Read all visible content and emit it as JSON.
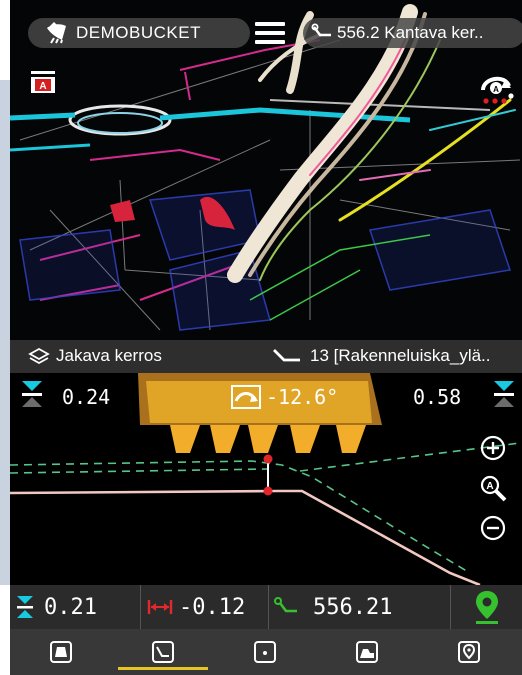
{
  "header": {
    "bucket_label": "DEMOBUCKET",
    "line_label": "556.2 Kantava ker..",
    "bucket_icon": "bucket-icon",
    "menu_icon": "hamburger-menu-icon",
    "line_icon": "alignment-line-icon"
  },
  "map": {
    "left_icon": "model-view-icon",
    "right_icon": "auto-rotate-icon"
  },
  "layer_bar": {
    "layer_label": "Jakava kerros",
    "surface_label": "13 [Rakenneluiska_ylä.."
  },
  "profile": {
    "left_depth": "0.24",
    "right_depth": "0.58",
    "tilt_value": "-12.6°",
    "zoom_in_icon": "zoom-in-icon",
    "zoom_auto_icon": "zoom-auto-icon",
    "zoom_out_icon": "zoom-out-icon"
  },
  "readouts": {
    "depth": "0.21",
    "distance": "-0.12",
    "station": "556.21"
  },
  "tabs": [
    {
      "name": "tab-excavator",
      "icon": "excavator-view-icon",
      "active": false
    },
    {
      "name": "tab-profile",
      "icon": "profile-view-icon",
      "active": true
    },
    {
      "name": "tab-point",
      "icon": "point-view-icon",
      "active": false
    },
    {
      "name": "tab-machine",
      "icon": "machine-view-icon",
      "active": false
    },
    {
      "name": "tab-location",
      "icon": "location-view-icon",
      "active": false
    }
  ],
  "colors": {
    "accent_yellow": "#e6c421",
    "gps_green": "#36c22e",
    "depth_cyan": "#19c9e0",
    "distance_red": "#e2292d",
    "station_green": "#36c22e"
  }
}
